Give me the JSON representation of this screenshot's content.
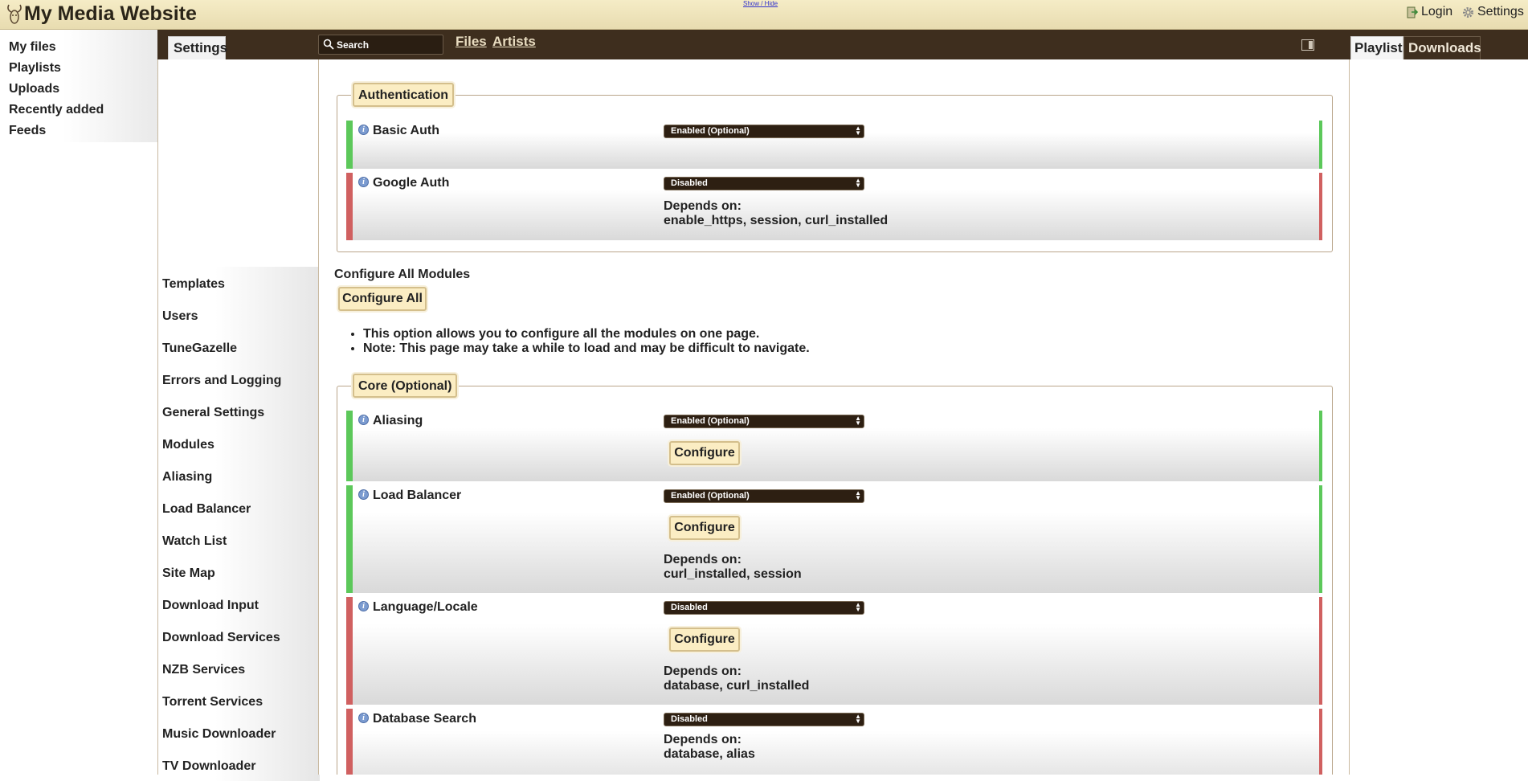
{
  "header": {
    "site_title": "My Media Website",
    "show_hide": "Show / Hide",
    "login": "Login",
    "settings": "Settings"
  },
  "left_nav": [
    "My files",
    "Playlists",
    "Uploads",
    "Recently added",
    "Feeds"
  ],
  "toolbar": {
    "settings_tab": "Settings",
    "search_placeholder": "Search",
    "files_link": "Files",
    "artists_link": "Artists",
    "playlist_tab": "Playlist",
    "downloads_tab": "Downloads"
  },
  "settings_list": [
    "Templates",
    "Users",
    "TuneGazelle",
    "Errors and Logging",
    "General Settings",
    "Modules",
    "Aliasing",
    "Load Balancer",
    "Watch List",
    "Site Map",
    "Download Input",
    "Download Services",
    "NZB Services",
    "Torrent Services",
    "Music Downloader",
    "TV Downloader"
  ],
  "authentication": {
    "legend": "Authentication",
    "modules": [
      {
        "name": "Basic Auth",
        "status": "Enabled (Optional)"
      },
      {
        "name": "Google Auth",
        "status": "Disabled",
        "depends_label": "Depends on:",
        "depends": "enable_https, session, curl_installed"
      }
    ]
  },
  "configure_all": {
    "title": "Configure All Modules",
    "button": "Configure All",
    "notes": [
      "This option allows you to configure all the modules on one page.",
      "Note: This page may take a while to load and may be difficult to navigate."
    ]
  },
  "core": {
    "legend": "Core (Optional)",
    "configure_label": "Configure",
    "modules": [
      {
        "name": "Aliasing",
        "status": "Enabled (Optional)"
      },
      {
        "name": "Load Balancer",
        "status": "Enabled (Optional)",
        "depends_label": "Depends on:",
        "depends": "curl_installed, session"
      },
      {
        "name": "Language/Locale",
        "status": "Disabled",
        "depends_label": "Depends on:",
        "depends": "database, curl_installed"
      },
      {
        "name": "Database Search",
        "status": "Disabled",
        "depends_label": "Depends on:",
        "depends": "database, alias"
      }
    ]
  },
  "colors": {
    "enabled": "#5cc85a",
    "disabled": "#d06060",
    "dark_bar": "#3e2e1e",
    "button_bg": "#fbedc3"
  }
}
